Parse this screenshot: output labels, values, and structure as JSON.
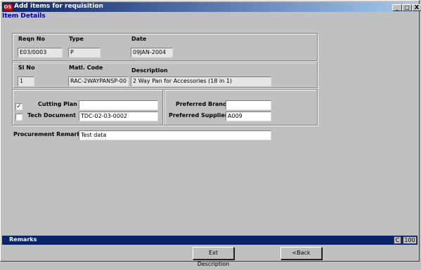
{
  "window": {
    "title": "Add items for requisition",
    "app_icon_text": "OS",
    "minimize": "_",
    "maximize": "□",
    "close": "X"
  },
  "section_title": "Item Details",
  "reqn": {
    "reqn_no_label": "Reqn No",
    "reqn_no_value": "E03/0003",
    "type_label": "Type",
    "type_value": "P",
    "date_label": "Date",
    "date_value": "09JAN-2004"
  },
  "item": {
    "sl_no_label": "Sl No",
    "sl_no_value": "1",
    "matl_code_label": "Matl. Code",
    "matl_code_value": "RAC-2WAYPANSP-00",
    "description_label": "Description",
    "description_value": "2 Way Pan for Accessories (18 in 1)"
  },
  "docs": {
    "cutting_plan_label": "Cutting Plan",
    "cutting_plan_checked": "✓",
    "cutting_plan_value": "",
    "tech_document_label": "Tech Document",
    "tech_document_checked": "",
    "tech_document_value": "TDC-02-03-0002"
  },
  "preferences": {
    "brand_label": "Preferred Brand",
    "brand_value": "",
    "supplier_label": "Preferred Supplier",
    "supplier_value": "A009"
  },
  "remarks": {
    "label": "Procurement Remarks",
    "value": "Test data"
  },
  "status": {
    "text": "Remarks",
    "mode": "C",
    "value": "100"
  },
  "buttons": {
    "ext_description": "Ext Description",
    "back": "<Back"
  }
}
